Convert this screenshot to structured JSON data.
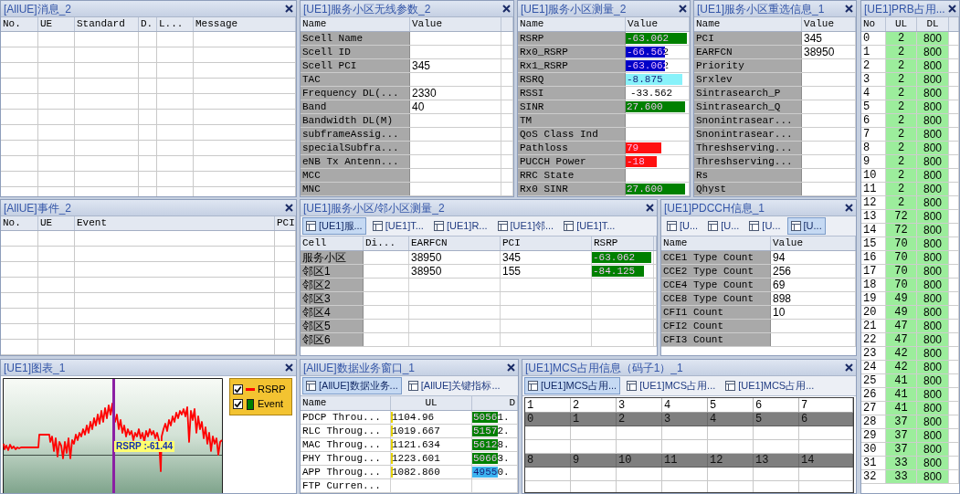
{
  "messages_panel": {
    "title": "[AllUE]消息_2",
    "columns": [
      "No.",
      "UE",
      "Standard",
      "D.",
      "L...",
      "Message"
    ]
  },
  "cell_params_panel": {
    "title": "[UE1]服务小区无线参数_2",
    "columns": [
      "Name",
      "Value"
    ],
    "rows": [
      {
        "name": "Scell Name"
      },
      {
        "name": "Scell ID"
      },
      {
        "name": "Scell PCI",
        "value": "345"
      },
      {
        "name": "TAC"
      },
      {
        "name": "Frequency DL(...",
        "value": "2330"
      },
      {
        "name": "Band",
        "value": "40"
      },
      {
        "name": "Bandwidth DL(M)"
      },
      {
        "name": "subframeAssig..."
      },
      {
        "name": "specialSubfra..."
      },
      {
        "name": "eNB Tx Antenn..."
      },
      {
        "name": "MCC"
      },
      {
        "name": "MNC"
      }
    ]
  },
  "measurement_panel": {
    "title": "[UE1]服务小区测量_2",
    "columns": [
      "Name",
      "Value"
    ],
    "rows": [
      {
        "name": "RSRP",
        "kind": "meter",
        "value": "-63.062",
        "level": 0.97,
        "color": "#008000"
      },
      {
        "name": "Rx0_RSRP",
        "kind": "meter",
        "value": "-66.562",
        "level": 0.62,
        "color": "#0000c8"
      },
      {
        "name": "Rx1_RSRP",
        "kind": "meter",
        "value": "-63.062",
        "level": 0.63,
        "color": "#0000c8"
      },
      {
        "name": "RSRQ",
        "kind": "meter",
        "value": "-8.875",
        "level": 0.9,
        "color": "#88f2fa"
      },
      {
        "name": "RSSI",
        "kind": "text",
        "value": "-33.562"
      },
      {
        "name": "SINR",
        "kind": "meter",
        "value": "27.600",
        "level": 0.94,
        "color": "#008000"
      },
      {
        "name": "TM",
        "kind": "text"
      },
      {
        "name": "QoS Class Ind",
        "kind": "text"
      },
      {
        "name": "Pathloss",
        "kind": "meter",
        "value": "79",
        "level": 0.57,
        "color": "#ff1010"
      },
      {
        "name": "PUCCH Power",
        "kind": "meter",
        "value": "-18",
        "level": 0.49,
        "color": "#ff1010"
      },
      {
        "name": "RRC State",
        "kind": "text"
      },
      {
        "name": "Rx0 SINR",
        "kind": "meter",
        "value": "27.600",
        "level": 0.94,
        "color": "#008000"
      }
    ]
  },
  "reselection_panel": {
    "title": "[UE1]服务小区重选信息_1",
    "columns": [
      "Name",
      "Value"
    ],
    "rows": [
      {
        "name": "PCI",
        "value": "345"
      },
      {
        "name": "EARFCN",
        "value": "38950"
      },
      {
        "name": "Priority"
      },
      {
        "name": "Srxlev"
      },
      {
        "name": "Sintrasearch_P"
      },
      {
        "name": "Sintrasearch_Q"
      },
      {
        "name": "Snonintrasear..."
      },
      {
        "name": "Snonintrasear..."
      },
      {
        "name": "Threshserving..."
      },
      {
        "name": "Threshserving..."
      },
      {
        "name": "Rs"
      },
      {
        "name": "Qhyst"
      }
    ]
  },
  "prb_panel": {
    "title": "[UE1]PRB占用...",
    "columns": [
      "No",
      "UL",
      "DL"
    ],
    "rows": [
      {
        "no": "0",
        "ul": "2",
        "dl": "800"
      },
      {
        "no": "1",
        "ul": "2",
        "dl": "800"
      },
      {
        "no": "2",
        "ul": "2",
        "dl": "800"
      },
      {
        "no": "3",
        "ul": "2",
        "dl": "800"
      },
      {
        "no": "4",
        "ul": "2",
        "dl": "800"
      },
      {
        "no": "5",
        "ul": "2",
        "dl": "800"
      },
      {
        "no": "6",
        "ul": "2",
        "dl": "800"
      },
      {
        "no": "7",
        "ul": "2",
        "dl": "800"
      },
      {
        "no": "8",
        "ul": "2",
        "dl": "800"
      },
      {
        "no": "9",
        "ul": "2",
        "dl": "800"
      },
      {
        "no": "10",
        "ul": "2",
        "dl": "800"
      },
      {
        "no": "11",
        "ul": "2",
        "dl": "800"
      },
      {
        "no": "12",
        "ul": "2",
        "dl": "800"
      },
      {
        "no": "13",
        "ul": "72",
        "dl": "800"
      },
      {
        "no": "14",
        "ul": "72",
        "dl": "800"
      },
      {
        "no": "15",
        "ul": "70",
        "dl": "800"
      },
      {
        "no": "16",
        "ul": "70",
        "dl": "800"
      },
      {
        "no": "17",
        "ul": "70",
        "dl": "800"
      },
      {
        "no": "18",
        "ul": "70",
        "dl": "800"
      },
      {
        "no": "19",
        "ul": "49",
        "dl": "800"
      },
      {
        "no": "20",
        "ul": "49",
        "dl": "800"
      },
      {
        "no": "21",
        "ul": "47",
        "dl": "800"
      },
      {
        "no": "22",
        "ul": "47",
        "dl": "800"
      },
      {
        "no": "23",
        "ul": "42",
        "dl": "800"
      },
      {
        "no": "24",
        "ul": "42",
        "dl": "800"
      },
      {
        "no": "25",
        "ul": "41",
        "dl": "800"
      },
      {
        "no": "26",
        "ul": "41",
        "dl": "800"
      },
      {
        "no": "27",
        "ul": "41",
        "dl": "800"
      },
      {
        "no": "28",
        "ul": "37",
        "dl": "800"
      },
      {
        "no": "29",
        "ul": "37",
        "dl": "800"
      },
      {
        "no": "30",
        "ul": "37",
        "dl": "800"
      },
      {
        "no": "31",
        "ul": "33",
        "dl": "800"
      },
      {
        "no": "32",
        "ul": "33",
        "dl": "800"
      }
    ]
  },
  "events_panel": {
    "title": "[AllUE]事件_2",
    "columns": [
      "No.",
      "UE",
      "Event",
      "PCI"
    ]
  },
  "neighbor_panel": {
    "title": "[UE1]服务小区/邻小区测量_2",
    "tabs": [
      {
        "label": "[UE1]服...",
        "selected": true
      },
      {
        "label": "[UE1]T...",
        "selected": false
      },
      {
        "label": "[UE1]R...",
        "selected": false
      },
      {
        "label": "[UE1]邻...",
        "selected": false
      },
      {
        "label": "[UE1]T...",
        "selected": false
      }
    ],
    "columns": [
      "Cell",
      "Di...",
      "EARFCN",
      "PCI",
      "RSRP"
    ],
    "rows": [
      {
        "cell": "服务小区",
        "earfcn": "38950",
        "pci": "345",
        "rsrp": {
          "value": "-63.062",
          "level": 0.97
        }
      },
      {
        "cell": "邻区1",
        "earfcn": "38950",
        "pci": "155",
        "rsrp": {
          "value": "-84.125",
          "level": 0.85
        }
      },
      {
        "cell": "邻区2"
      },
      {
        "cell": "邻区3"
      },
      {
        "cell": "邻区4"
      },
      {
        "cell": "邻区5"
      },
      {
        "cell": "邻区6"
      }
    ]
  },
  "pdcch_panel": {
    "title": "[UE1]PDCCH信息_1",
    "tabs": [
      {
        "label": "[U...",
        "selected": false
      },
      {
        "label": "[U...",
        "selected": false
      },
      {
        "label": "[U...",
        "selected": false
      },
      {
        "label": "[U...",
        "selected": true
      }
    ],
    "columns": [
      "Name",
      "Value"
    ],
    "rows": [
      {
        "name": "CCE1 Type Count",
        "value": "94"
      },
      {
        "name": "CCE2 Type Count",
        "value": "256"
      },
      {
        "name": "CCE4 Type Count",
        "value": "69"
      },
      {
        "name": "CCE8 Type Count",
        "value": "898"
      },
      {
        "name": "CFI1 Count",
        "value": "10"
      },
      {
        "name": "CFI2 Count"
      },
      {
        "name": "CFI3 Count"
      }
    ]
  },
  "chart_panel": {
    "title": "[UE1]图表_1",
    "cursor_label": "RSRP :-61.44",
    "legend": [
      {
        "label": "RSRP",
        "checked": true,
        "kind": "line",
        "color": "#ff0000"
      },
      {
        "label": "Event",
        "checked": true,
        "kind": "bar",
        "color": "#008000"
      }
    ]
  },
  "data_panel": {
    "title": "[AllUE]数据业务窗口_1",
    "tabs": [
      {
        "label": "[AllUE]数据业务...",
        "selected": true
      },
      {
        "label": "[AllUE]关键指标...",
        "selected": false
      }
    ],
    "columns": [
      "Name",
      "UL",
      "D"
    ],
    "rows": [
      {
        "name": "PDCP Throu...",
        "ul": {
          "value": "1104.96",
          "level": 0.02
        },
        "dl": {
          "value": "50561.",
          "level": 0.58,
          "color": "#008000"
        }
      },
      {
        "name": "RLC Throug...",
        "ul": {
          "value": "1019.667",
          "level": 0.02
        },
        "dl": {
          "value": "51572.",
          "level": 0.58,
          "color": "#008000"
        }
      },
      {
        "name": "MAC Throug...",
        "ul": {
          "value": "1121.634",
          "level": 0.02
        },
        "dl": {
          "value": "56128.",
          "level": 0.58,
          "color": "#008000"
        }
      },
      {
        "name": "PHY Throug...",
        "ul": {
          "value": "1223.601",
          "level": 0.02
        },
        "dl": {
          "value": "50663.",
          "level": 0.58,
          "color": "#008000"
        }
      },
      {
        "name": "APP Throug...",
        "ul": {
          "value": "1082.860",
          "level": 0.02
        },
        "dl": {
          "value": "49550.",
          "level": 0.58,
          "color": "#3cb4f0"
        }
      },
      {
        "name": "FTP Curren..."
      }
    ]
  },
  "mcs_panel": {
    "title": "[UE1]MCS占用信息（码子1）_1",
    "tabs": [
      {
        "label": "[UE1]MCS占用...",
        "selected": true
      },
      {
        "label": "[UE1]MCS占用...",
        "selected": false
      },
      {
        "label": "[UE1]MCS占用...",
        "selected": false
      }
    ],
    "columns": [
      "1",
      "2",
      "3",
      "4",
      "5",
      "6",
      "7"
    ],
    "rows": [
      {
        "cells": [
          "0",
          "1",
          "2",
          "3",
          "4",
          "5",
          "6"
        ]
      },
      {
        "cells": [
          "8",
          "9",
          "10",
          "11",
          "12",
          "13",
          "14"
        ]
      }
    ]
  }
}
